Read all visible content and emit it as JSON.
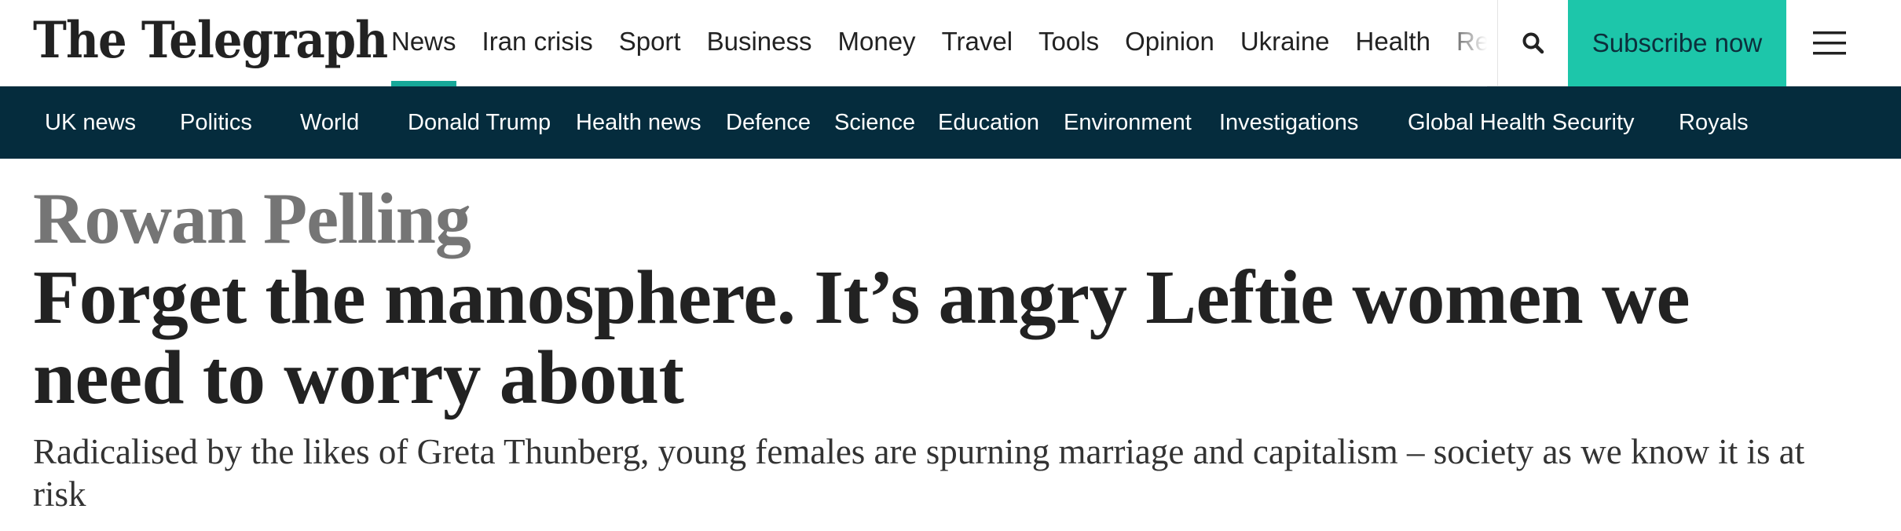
{
  "brand": {
    "logo_text": "The Telegraph"
  },
  "primary_nav": {
    "items": [
      {
        "label": "News",
        "active": true
      },
      {
        "label": "Iran crisis"
      },
      {
        "label": "Sport"
      },
      {
        "label": "Business"
      },
      {
        "label": "Money"
      },
      {
        "label": "Travel"
      },
      {
        "label": "Tools"
      },
      {
        "label": "Opinion"
      },
      {
        "label": "Ukraine"
      },
      {
        "label": "Health"
      },
      {
        "label": "Rec"
      }
    ],
    "search_icon": "search-icon",
    "subscribe_label": "Subscribe now",
    "menu_icon": "hamburger-menu-icon"
  },
  "secondary_nav": {
    "items": [
      {
        "label": "UK news"
      },
      {
        "label": "Politics"
      },
      {
        "label": "World"
      },
      {
        "label": "Donald Trump"
      },
      {
        "label": "Health news"
      },
      {
        "label": "Defence"
      },
      {
        "label": "Science"
      },
      {
        "label": "Education"
      },
      {
        "label": "Environment"
      },
      {
        "label": "Investigations"
      },
      {
        "label": "Global Health Security"
      },
      {
        "label": "Royals"
      }
    ]
  },
  "article": {
    "byline": "Rowan Pelling",
    "headline": "Forget the manosphere. It’s angry Leftie women we need to worry about",
    "standfirst": "Radicalised by the likes of Greta Thunberg, young females are spurning marriage and capitalism – society as we know it is at risk"
  },
  "colors": {
    "accent": "#17a899",
    "subscribe_bg": "#1dc6aa",
    "subnav_bg": "#052c3d",
    "byline": "#757575"
  }
}
